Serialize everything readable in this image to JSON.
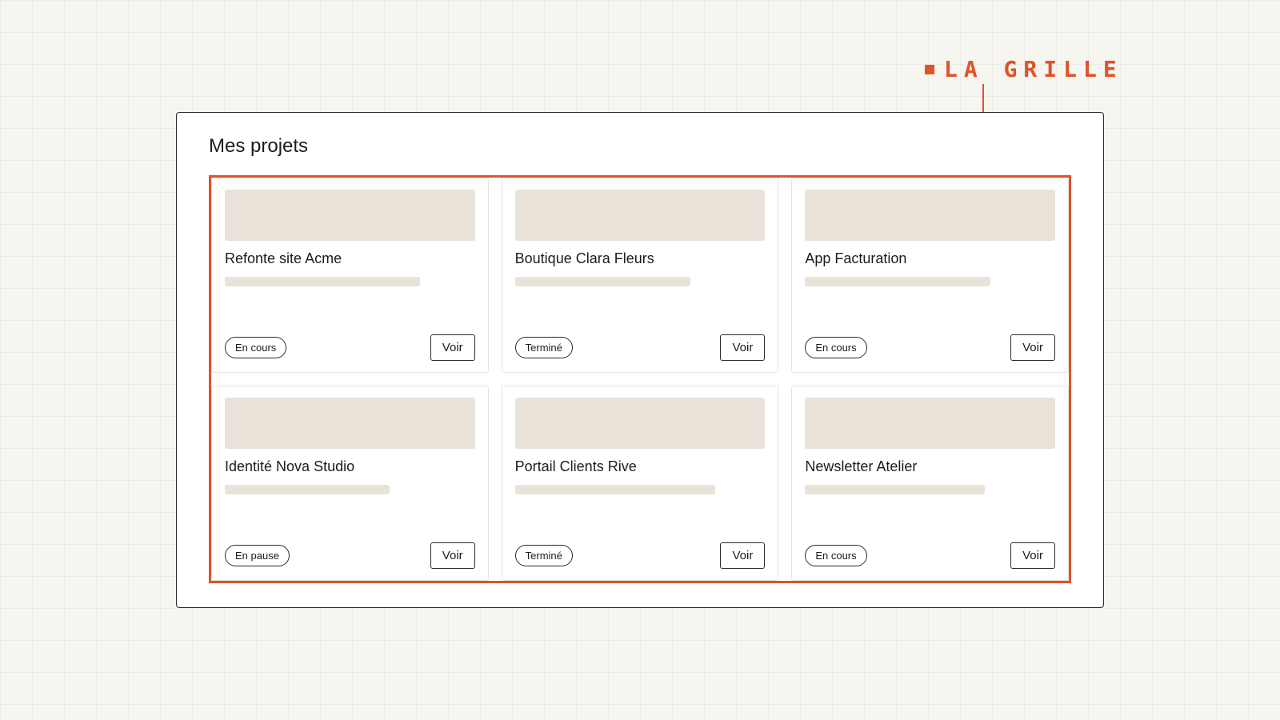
{
  "annotation": {
    "label": "LA GRILLE",
    "color": "#e0532a"
  },
  "page": {
    "title": "Mes projets"
  },
  "colors": {
    "accent": "#e0532a",
    "placeholder": "#e8e2d8",
    "background": "#f7f5f0"
  },
  "projects": [
    {
      "title": "Refonte site Acme",
      "status": "En cours",
      "action": "Voir",
      "bar_fill": 0.78
    },
    {
      "title": "Boutique Clara Fleurs",
      "status": "Terminé",
      "action": "Voir",
      "bar_fill": 0.7
    },
    {
      "title": "App Facturation",
      "status": "En cours",
      "action": "Voir",
      "bar_fill": 0.74
    },
    {
      "title": "Identité Nova Studio",
      "status": "En pause",
      "action": "Voir",
      "bar_fill": 0.66
    },
    {
      "title": "Portail Clients Rive",
      "status": "Terminé",
      "action": "Voir",
      "bar_fill": 0.8
    },
    {
      "title": "Newsletter Atelier",
      "status": "En cours",
      "action": "Voir",
      "bar_fill": 0.72
    }
  ]
}
